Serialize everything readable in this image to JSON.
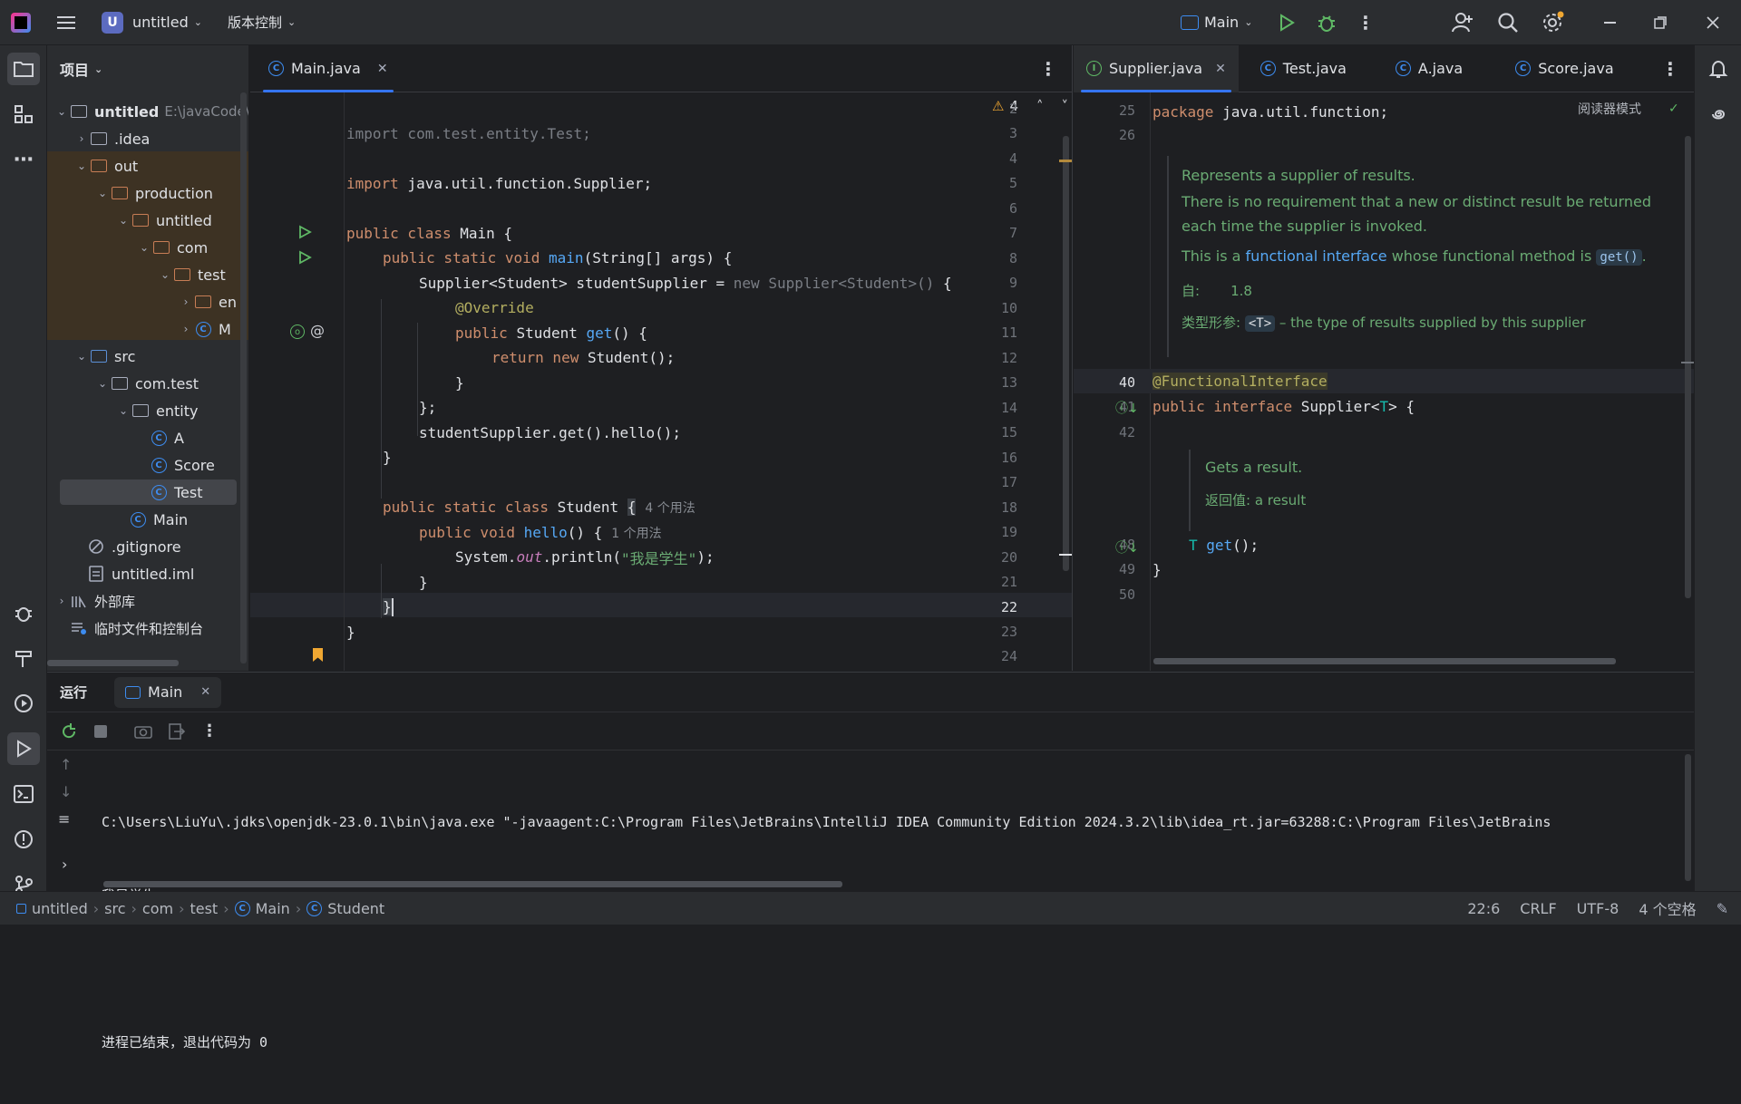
{
  "titlebar": {
    "project_badge": "U",
    "project_name": "untitled",
    "vcs_label": "版本控制",
    "run_config": "Main"
  },
  "project_panel": {
    "title": "项目",
    "tree": [
      {
        "label": "untitled",
        "path": "E:\\javaCode\\"
      },
      {
        "label": ".idea"
      },
      {
        "label": "out"
      },
      {
        "label": "production"
      },
      {
        "label": "untitled"
      },
      {
        "label": "com"
      },
      {
        "label": "test"
      },
      {
        "label": "en"
      },
      {
        "label": "M"
      },
      {
        "label": "src"
      },
      {
        "label": "com.test"
      },
      {
        "label": "entity"
      },
      {
        "label": "A"
      },
      {
        "label": "Score"
      },
      {
        "label": "Test"
      },
      {
        "label": "Main"
      },
      {
        "label": ".gitignore"
      },
      {
        "label": "untitled.iml"
      },
      {
        "label": "外部库"
      },
      {
        "label": "临时文件和控制台"
      }
    ]
  },
  "editor_left": {
    "tab": "Main.java",
    "warnings": "4",
    "line_numbers": [
      "2",
      "3",
      "4",
      "5",
      "6",
      "7",
      "8",
      "9",
      "10",
      "11",
      "12",
      "13",
      "14",
      "15",
      "16",
      "17",
      "18",
      "19",
      "20",
      "21",
      "22",
      "23",
      "24"
    ],
    "lines": {
      "l3": "import com.test.entity.Test;",
      "l5a": "import ",
      "l5b": "java.util.function.Supplier;",
      "l7a": "public class ",
      "l7b": "Main {",
      "l8a": "public static void ",
      "l8b": "main",
      "l8c": "(String[] args) {",
      "l9a": "Supplier<Student> studentSupplier = ",
      "l9b": "new Supplier<Student>()",
      "l9c": " {",
      "l10": "@Override",
      "l11a": "public ",
      "l11b": "Student ",
      "l11c": "get",
      "l11d": "() {",
      "l12a": "return new ",
      "l12b": "Student();",
      "l13": "}",
      "l14": "};",
      "l15": "studentSupplier.get().hello();",
      "l16": "}",
      "l18a": "public static class ",
      "l18b": "Student ",
      "l18c": "{",
      "l18hint": "4 个用法",
      "l19a": "public void ",
      "l19b": "hello",
      "l19c": "() {",
      "l19hint": "1 个用法",
      "l20a": "System.",
      "l20b": "out",
      "l20c": ".println(",
      "l20d": "\"我是学生\"",
      "l20e": ");",
      "l21": "}",
      "l22": "}",
      "l23": "}"
    }
  },
  "editor_right": {
    "tabs": [
      "Supplier.java",
      "Test.java",
      "A.java",
      "Score.java"
    ],
    "reader_mode": "阅读器模式",
    "line_numbers": {
      "a": "25",
      "b": "26",
      "c": "40",
      "d": "41",
      "e": "42",
      "f": "48",
      "g": "49",
      "h": "50"
    },
    "l25a": "package ",
    "l25b": "java.util.function;",
    "doc1": "Represents a supplier of results.",
    "doc2": "There is no requirement that a new or distinct result be returned each time the supplier is invoked.",
    "doc3a": "This is a ",
    "doc3b": "functional interface",
    "doc3c": " whose functional method is ",
    "doc3d": "get()",
    "doc3e": ".",
    "since_label": "自:",
    "since_value": "1.8",
    "param_label": "类型形参:",
    "param_chip": "<T>",
    "param_desc": " – the type of results supplied by this supplier",
    "l40": "@FunctionalInterface",
    "l41a": "public interface ",
    "l41b": "Supplier<",
    "l41c": "T",
    "l41d": "> {",
    "doc4": "Gets a result.",
    "ret_label": "返回值:",
    "ret_value": " a result",
    "l48a": "T ",
    "l48b": "get",
    "l48c": "();",
    "l49": "}"
  },
  "run_panel": {
    "title": "运行",
    "tab": "Main",
    "cmd": "C:\\Users\\LiuYu\\.jdks\\openjdk-23.0.1\\bin\\java.exe \"-javaagent:C:\\Program Files\\JetBrains\\IntelliJ IDEA Community Edition 2024.3.2\\lib\\idea_rt.jar=63288:C:\\Program Files\\JetBrains",
    "out1": "我是学生",
    "out2": "进程已结束，退出代码为 0"
  },
  "statusbar": {
    "crumbs": [
      "untitled",
      "src",
      "com",
      "test",
      "Main",
      "Student"
    ],
    "position": "22:6",
    "line_sep": "CRLF",
    "encoding": "UTF-8",
    "indent": "4 个空格"
  }
}
